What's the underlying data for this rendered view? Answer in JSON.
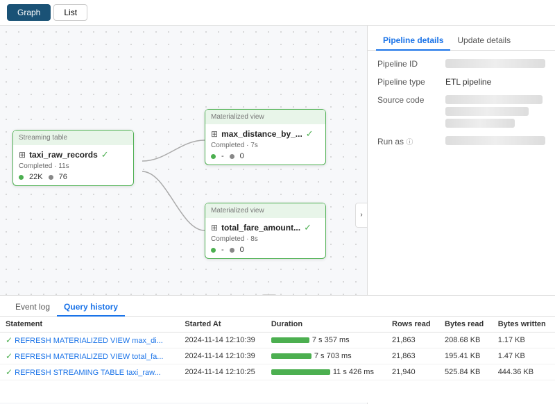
{
  "toolbar": {
    "graph_label": "Graph",
    "list_label": "List"
  },
  "graph": {
    "nodes": [
      {
        "id": "streaming",
        "label": "Streaming table",
        "icon": "⊞",
        "title": "taxi_raw_records",
        "status": "Completed · 11s",
        "metrics": [
          "22K",
          "76"
        ]
      },
      {
        "id": "mat1",
        "label": "Materialized view",
        "icon": "⊞",
        "title": "max_distance_by_...",
        "status": "Completed · 7s",
        "metrics": [
          "-",
          "0"
        ]
      },
      {
        "id": "mat2",
        "label": "Materialized view",
        "icon": "⊞",
        "title": "total_fare_amount...",
        "status": "Completed · 8s",
        "metrics": [
          "-",
          "0"
        ]
      }
    ],
    "collapse_icon": "›"
  },
  "right_panel": {
    "tabs": [
      "Pipeline details",
      "Update details"
    ],
    "active_tab": "Pipeline details",
    "fields": [
      {
        "label": "Pipeline ID",
        "value": "blurred",
        "blurred": true
      },
      {
        "label": "Pipeline type",
        "value": "ETL pipeline",
        "blurred": false
      },
      {
        "label": "Source code",
        "value": "blurred",
        "blurred": true
      },
      {
        "label": "Run as",
        "value": "blurred",
        "blurred": true
      }
    ],
    "run_as_info_icon": "ⓘ"
  },
  "bottom": {
    "tabs": [
      "Event log",
      "Query history"
    ],
    "active_tab": "Query history",
    "table_headers": [
      "Statement",
      "Started At",
      "Duration",
      "Rows read",
      "Bytes read",
      "Bytes written"
    ],
    "rows": [
      {
        "status": "✓",
        "statement": "REFRESH MATERIALIZED VIEW max_di...",
        "started_at": "2024-11-14 12:10:39",
        "duration": "7 s 357 ms",
        "duration_bar_width": 55,
        "rows_read": "21,863",
        "bytes_read": "208.68 KB",
        "bytes_written": "1.17 KB"
      },
      {
        "status": "✓",
        "statement": "REFRESH MATERIALIZED VIEW total_fa...",
        "started_at": "2024-11-14 12:10:39",
        "duration": "7 s 703 ms",
        "duration_bar_width": 58,
        "rows_read": "21,863",
        "bytes_read": "195.41 KB",
        "bytes_written": "1.47 KB"
      },
      {
        "status": "✓",
        "statement": "REFRESH STREAMING TABLE taxi_raw...",
        "started_at": "2024-11-14 12:10:25",
        "duration": "11 s 426 ms",
        "duration_bar_width": 85,
        "rows_read": "21,940",
        "bytes_read": "525.84 KB",
        "bytes_written": "444.36 KB"
      }
    ]
  }
}
